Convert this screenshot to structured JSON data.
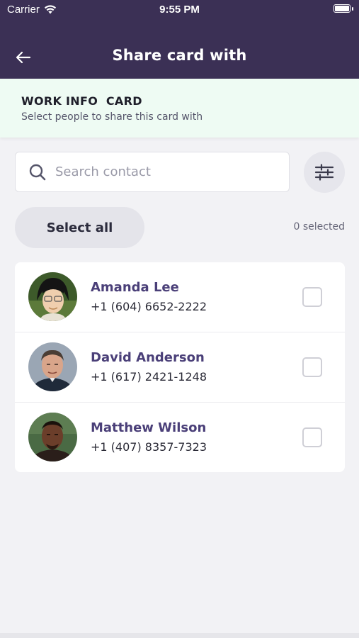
{
  "status_bar": {
    "carrier": "Carrier",
    "time": "9:55 PM"
  },
  "header": {
    "title": "Share card with"
  },
  "banner": {
    "title": "WORK INFO  CARD",
    "subtitle": "Select people to share this card with"
  },
  "search": {
    "placeholder": "Search contact",
    "value": ""
  },
  "actions": {
    "select_all_label": "Select all",
    "selected_count": "0 selected"
  },
  "contacts": [
    {
      "name": "Amanda Lee",
      "phone": "+1 (604) 6652-2222",
      "selected": false
    },
    {
      "name": "David Anderson",
      "phone": "+1 (617) 2421-1248",
      "selected": false
    },
    {
      "name": "Matthew Wilson",
      "phone": "+1 (407) 8357-7323",
      "selected": false
    }
  ],
  "colors": {
    "header_bg": "#3b3055",
    "banner_bg": "#eefbf3",
    "name_color": "#4a3f78",
    "page_bg": "#f2f2f5"
  },
  "icons": {
    "back": "arrow-left-icon",
    "search": "search-icon",
    "filter": "sliders-icon",
    "wifi": "wifi-icon",
    "battery": "battery-icon"
  }
}
